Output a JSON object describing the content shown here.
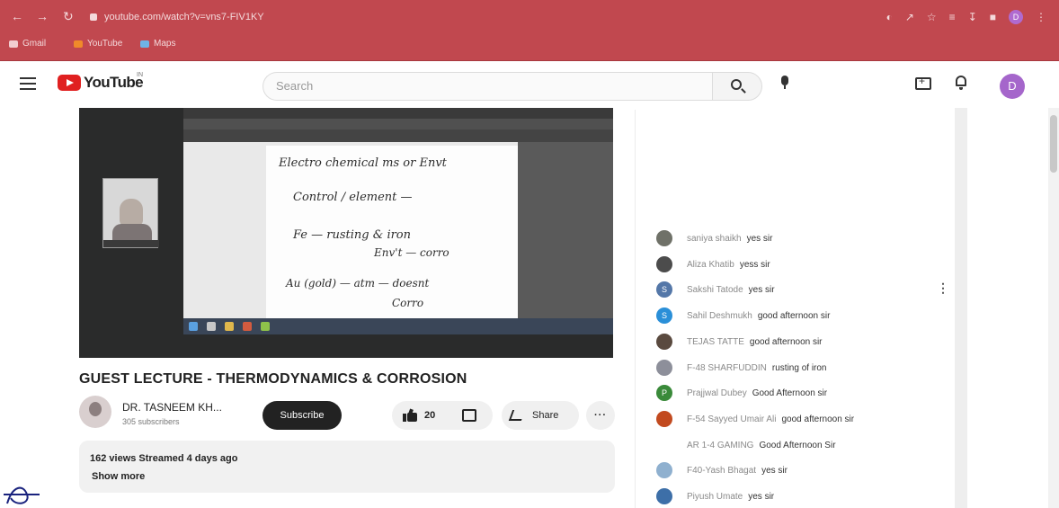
{
  "browser": {
    "url": "youtube.com/watch?v=vns7-FIV1KY",
    "bookmarks": [
      {
        "label": "Gmail",
        "color": "#f2cdd0"
      },
      {
        "label": "YouTube",
        "color": "#f08a2a"
      },
      {
        "label": "Maps",
        "color": "#6fb3e6"
      }
    ],
    "profile_initial": "D"
  },
  "header": {
    "logo_text": "YouTube",
    "country_code": "IN",
    "search_placeholder": "Search",
    "avatar_initial": "D"
  },
  "video": {
    "title": "GUEST LECTURE - THERMODYNAMICS & CORROSION",
    "channel_name": "DR. TASNEEM KH...",
    "subscribers": "305 subscribers",
    "subscribe_label": "Subscribe",
    "like_count": "20",
    "share_label": "Share",
    "more_label": "···",
    "views_line": "162 views  Streamed 4 days ago",
    "show_more": "Show more",
    "slide_lines": [
      "Electro chemical ms or Envt",
      "Control / element —",
      "Fe — rusting & iron",
      "Env't — corro",
      "Au (gold) — atm — doesnt",
      "Corro"
    ]
  },
  "chat": {
    "messages": [
      {
        "author": "saniya shaikh",
        "text": "yes sir",
        "avatar_color": "#6f7168",
        "initial": ""
      },
      {
        "author": "Aliza Khatib",
        "text": "yess sir",
        "avatar_color": "#4c4c4c",
        "initial": ""
      },
      {
        "author": "Sakshi Tatode",
        "text": "yes sir",
        "avatar_color": "#5477a8",
        "initial": "S"
      },
      {
        "author": "Sahil Deshmukh",
        "text": "good afternoon sir",
        "avatar_color": "#2a8fd8",
        "initial": "S"
      },
      {
        "author": "TEJAS TATTE",
        "text": "good afternoon sir",
        "avatar_color": "#5a4a3f",
        "initial": ""
      },
      {
        "author": "F-48 SHARFUDDIN",
        "text": "rusting of iron",
        "avatar_color": "#8d8f9a",
        "initial": ""
      },
      {
        "author": "Prajjwal Dubey",
        "text": "Good Afternoon sir",
        "avatar_color": "#3a8a3a",
        "initial": "P"
      },
      {
        "author": "F-54 Sayyed Umair Ali",
        "text": "good afternoon sir",
        "avatar_color": "#c24a1f",
        "initial": ""
      },
      {
        "author": "AR 1-4 GAMING",
        "text": "Good Afternoon Sir",
        "avatar_color": "#ffffff",
        "initial": ""
      },
      {
        "author": "F40-Yash Bhagat",
        "text": "yes sir",
        "avatar_color": "#8fb0cf",
        "initial": ""
      },
      {
        "author": "Piyush Umate",
        "text": "yes sir",
        "avatar_color": "#3d6fa8",
        "initial": ""
      }
    ]
  }
}
